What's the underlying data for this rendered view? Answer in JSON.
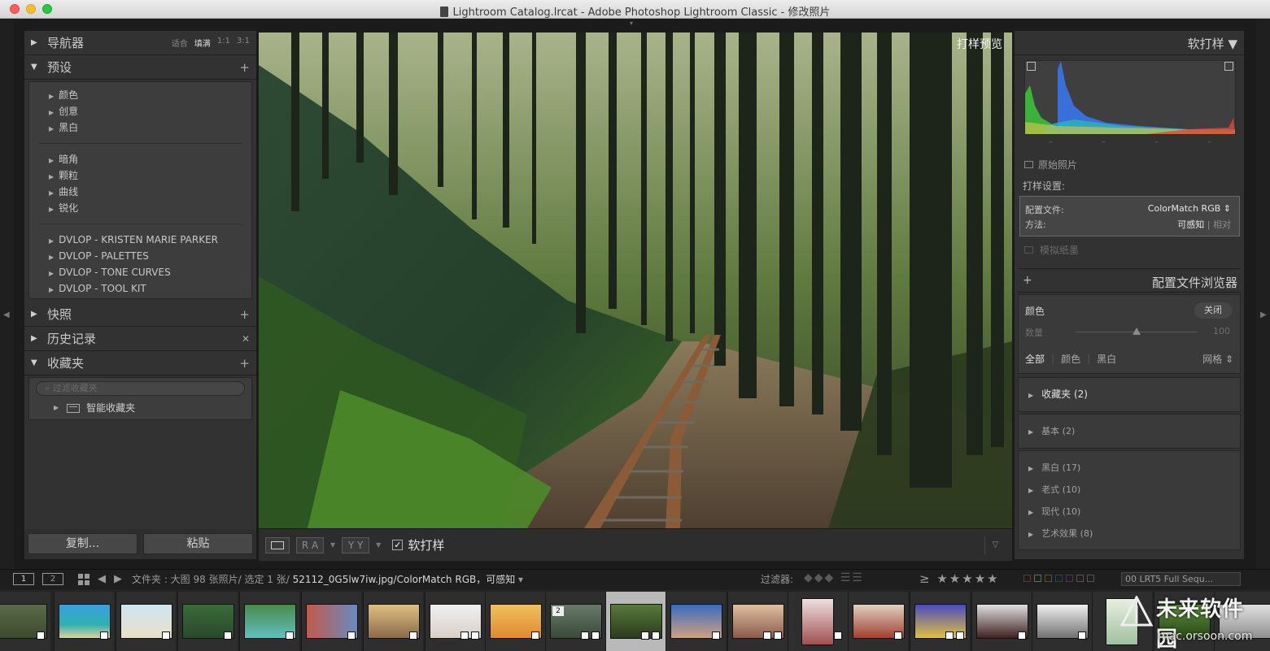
{
  "window": {
    "title": "Lightroom Catalog.lrcat - Adobe Photoshop Lightroom Classic - 修改照片"
  },
  "left": {
    "navigator": {
      "title": "导航器",
      "zooms": [
        "适合",
        "填满",
        "1:1",
        "3:1"
      ],
      "active_zoom": 1
    },
    "presets": {
      "title": "预设",
      "groups": [
        [
          "颜色",
          "创意",
          "黑白"
        ],
        [
          "暗角",
          "颗粒",
          "曲线",
          "锐化"
        ],
        [
          "DVLOP - KRISTEN MARIE PARKER",
          "DVLOP - PALETTES",
          "DVLOP - TONE CURVES",
          "DVLOP - TOOL KIT"
        ]
      ]
    },
    "snapshots": {
      "title": "快照"
    },
    "history": {
      "title": "历史记录"
    },
    "collections": {
      "title": "收藏夹",
      "search_placeholder": "过滤收藏夹",
      "smart": "智能收藏夹"
    },
    "buttons": {
      "copy": "复制...",
      "paste": "粘贴"
    }
  },
  "center": {
    "proof_label": "打样预览",
    "toolbar": {
      "btn_ra": "R A",
      "btn_yy": "Y Y",
      "softproof": "软打样"
    }
  },
  "right": {
    "softproof_title": "软打样",
    "original_photo": "原始照片",
    "proof_settings_label": "打样设置:",
    "profile_label": "配置文件:",
    "profile_value": "ColorMatch RGB",
    "method_label": "方法:",
    "method_perceptual": "可感知",
    "method_relative": "相对",
    "simulate_paper": "模拟纸墨",
    "profile_browser_title": "配置文件浏览器",
    "pb_color": "颜色",
    "pb_close": "关闭",
    "amount_label": "数量",
    "amount_value": "100",
    "amount_level": 0.5,
    "filters": [
      "全部",
      "颜色",
      "黑白"
    ],
    "grid_label": "网格",
    "groups": [
      {
        "label": "收藏夹 (2)"
      },
      {
        "label": "基本 (2)"
      },
      {
        "label": "黑白 (17)"
      },
      {
        "label": "老式 (10)"
      },
      {
        "label": "现代 (10)"
      },
      {
        "label": "艺术效果 (8)"
      }
    ]
  },
  "filmstrip": {
    "pages": [
      "1",
      "2"
    ],
    "folder_text": "文件夹 : 大图",
    "count_text": "98 张照片/ 选定 1 张/",
    "file_text": "52112_0G5lw7iw.jpg/ColorMatch RGB，可感知",
    "filter_label": "过滤器:",
    "rating_op": "≥",
    "preset_select": "00 LRT5 Full Sequ...",
    "stack_count": "2"
  },
  "watermark": {
    "title": "未来软件园",
    "subtitle": "mac.orsoon.com"
  },
  "colors": {
    "panel": "#323232",
    "background": "#1b1b1b",
    "selected_thumb": "#b9b9b9"
  }
}
